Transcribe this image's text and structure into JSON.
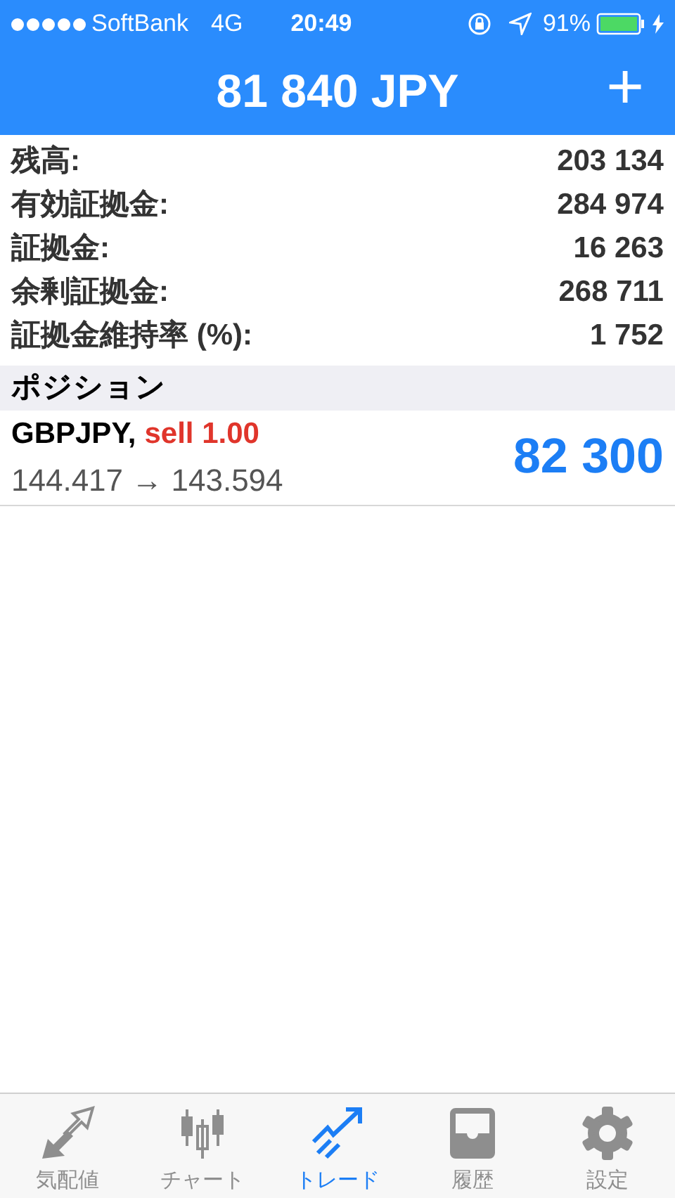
{
  "status_bar": {
    "carrier": "SoftBank",
    "network": "4G",
    "time": "20:49",
    "battery": "91%"
  },
  "header": {
    "title": "81 840 JPY",
    "add": "+"
  },
  "summary": [
    {
      "label": "残高:",
      "value": "203 134"
    },
    {
      "label": "有効証拠金:",
      "value": "284 974"
    },
    {
      "label": "証拠金:",
      "value": "16 263"
    },
    {
      "label": "余剰証拠金:",
      "value": "268 711"
    },
    {
      "label": "証拠金維持率 (%):",
      "value": "1 752"
    }
  ],
  "section": "ポジション",
  "positions": [
    {
      "symbol": "GBPJPY,",
      "order": "sell 1.00",
      "prices": "144.417 → 143.594",
      "profit": "82 300"
    }
  ],
  "tabs": [
    {
      "label": "気配値",
      "kind": "quotes",
      "selected": false
    },
    {
      "label": "チャート",
      "kind": "chart",
      "selected": false
    },
    {
      "label": "トレード",
      "kind": "trade",
      "selected": true
    },
    {
      "label": "履歴",
      "kind": "history",
      "selected": false
    },
    {
      "label": "設定",
      "kind": "settings",
      "selected": false
    }
  ]
}
